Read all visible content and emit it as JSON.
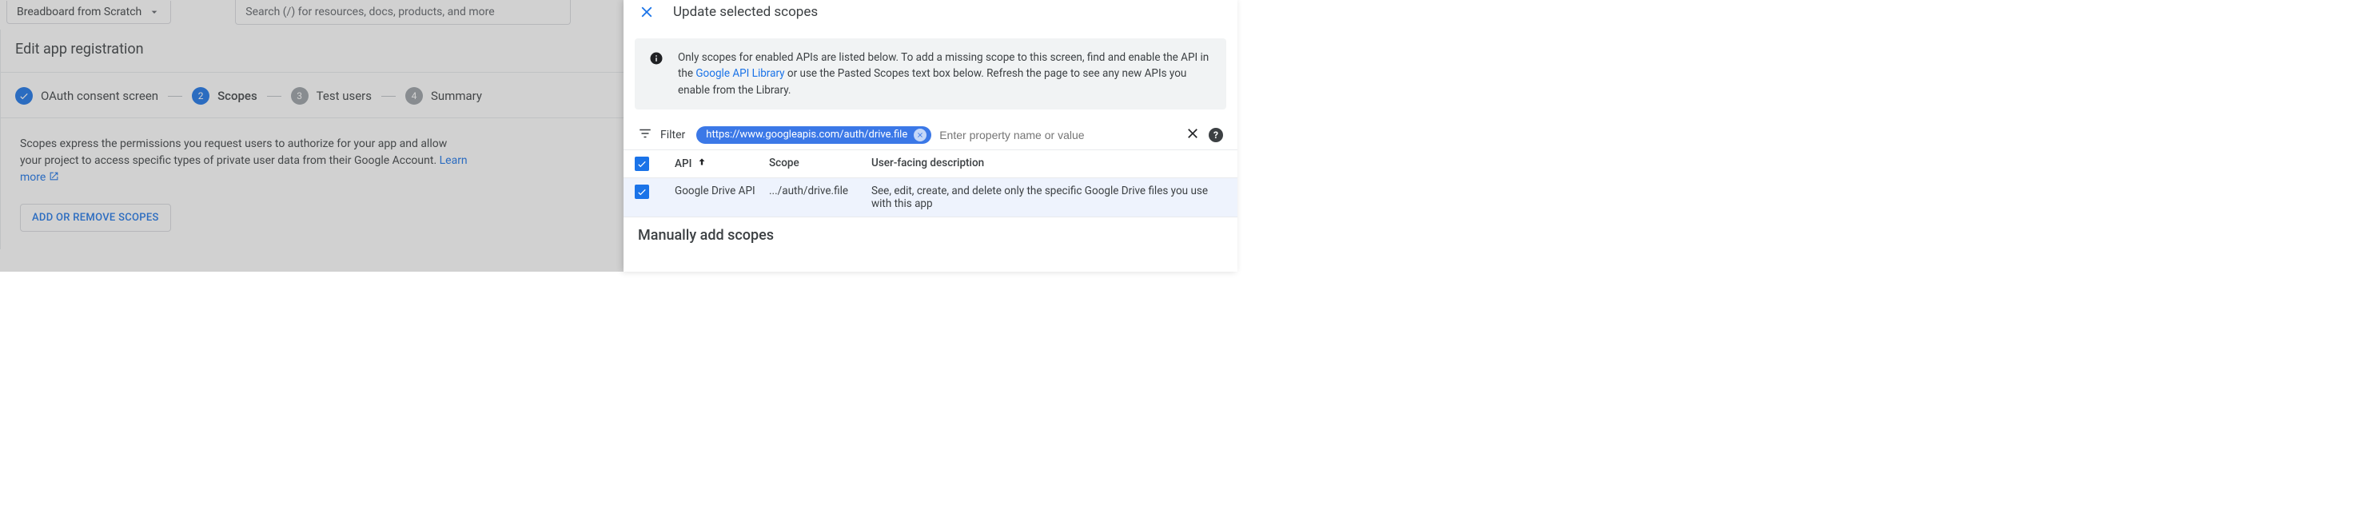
{
  "topbar": {
    "project_name": "Breadboard from Scratch",
    "search_placeholder": "Search (/) for resources, docs, products, and more"
  },
  "page": {
    "title": "Edit app registration"
  },
  "stepper": {
    "steps": [
      {
        "label": "OAuth consent screen"
      },
      {
        "label": "Scopes",
        "num": "2"
      },
      {
        "label": "Test users",
        "num": "3"
      },
      {
        "label": "Summary",
        "num": "4"
      }
    ]
  },
  "scopes_section": {
    "description": "Scopes express the permissions you request users to authorize for your app and allow your project to access specific types of private user data from their Google Account. ",
    "learn_more": "Learn more",
    "button": "ADD OR REMOVE SCOPES"
  },
  "panel": {
    "title": "Update selected scopes",
    "info_text_1": "Only scopes for enabled APIs are listed below. To add a missing scope to this screen, find and enable the API in the ",
    "info_link": "Google API Library",
    "info_text_2": " or use the Pasted Scopes text box below. Refresh the page to see any new APIs you enable from the Library.",
    "filter": {
      "label": "Filter",
      "chip_text": "https://www.googleapis.com/auth/drive.file",
      "input_placeholder": "Enter property name or value"
    },
    "table": {
      "headers": {
        "api": "API",
        "scope": "Scope",
        "description": "User-facing description"
      },
      "rows": [
        {
          "api": "Google Drive API",
          "scope": ".../auth/drive.file",
          "description": "See, edit, create, and delete only the specific Google Drive files you use with this app"
        }
      ]
    },
    "manual_heading": "Manually add scopes"
  }
}
